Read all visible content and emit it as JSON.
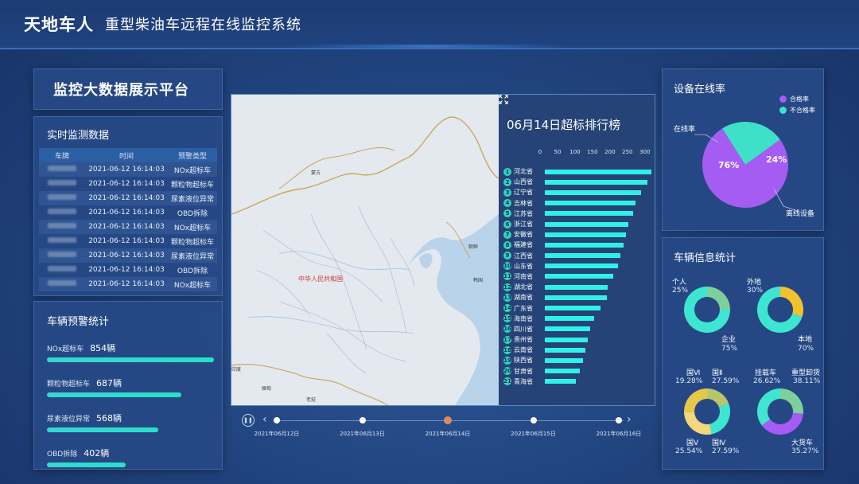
{
  "header": {
    "brand": "天地车人",
    "subtitle": "重型柴油车远程在线监控系统"
  },
  "platform": {
    "title": "监控大数据展示平台"
  },
  "realtime": {
    "title": "实时监测数据",
    "columns": [
      "车牌",
      "时间",
      "预警类型"
    ],
    "rows": [
      {
        "time": "2021-06-12  16:14:03",
        "type": "NOx超标车"
      },
      {
        "time": "2021-06-12  16:14:03",
        "type": "颗粒物超标车"
      },
      {
        "time": "2021-06-12  16:14:03",
        "type": "尿素液位异常"
      },
      {
        "time": "2021-06-12  16:14:03",
        "type": "OBD拆除"
      },
      {
        "time": "2021-06-12  16:14:03",
        "type": "NOx超标车"
      },
      {
        "time": "2021-06-12  16:14:03",
        "type": "颗粒物超标车"
      },
      {
        "time": "2021-06-12  16:14:03",
        "type": "尿素液位异常"
      },
      {
        "time": "2021-06-12  16:14:03",
        "type": "OBD拆除"
      },
      {
        "time": "2021-06-12  16:14:03",
        "type": "NOx超标车"
      }
    ]
  },
  "warning": {
    "title": "车辆预警统计",
    "items": [
      {
        "label": "NOx超标车",
        "count": "854辆",
        "value": 854
      },
      {
        "label": "颗粒物超标车",
        "count": "687辆",
        "value": 687
      },
      {
        "label": "尿素液位异常",
        "count": "568辆",
        "value": 568
      },
      {
        "label": "OBD拆除",
        "count": "402辆",
        "value": 402
      }
    ],
    "max": 854
  },
  "map": {
    "labels": [
      {
        "text": "中华人民共和国",
        "red": true
      },
      {
        "text": "蒙古",
        "red": false
      },
      {
        "text": "朝鲜",
        "red": false
      },
      {
        "text": "韩国",
        "red": false
      },
      {
        "text": "缅甸",
        "red": false
      },
      {
        "text": "老挝",
        "red": false
      },
      {
        "text": "印度",
        "red": false
      }
    ]
  },
  "ranking": {
    "title": "06月14日超标排行榜",
    "axis_ticks": [
      0,
      50,
      100,
      150,
      200,
      250,
      300
    ],
    "axis_max": 305,
    "items": [
      {
        "rank": 1,
        "name": "河北省",
        "value": 305
      },
      {
        "rank": 2,
        "name": "山西省",
        "value": 293
      },
      {
        "rank": 3,
        "name": "辽宁省",
        "value": 275
      },
      {
        "rank": 4,
        "name": "吉林省",
        "value": 260
      },
      {
        "rank": 5,
        "name": "江苏省",
        "value": 253
      },
      {
        "rank": 6,
        "name": "浙江省",
        "value": 240
      },
      {
        "rank": 7,
        "name": "安徽省",
        "value": 233
      },
      {
        "rank": 8,
        "name": "福建省",
        "value": 225
      },
      {
        "rank": 9,
        "name": "江西省",
        "value": 217
      },
      {
        "rank": 10,
        "name": "山东省",
        "value": 210
      },
      {
        "rank": 11,
        "name": "河南省",
        "value": 195
      },
      {
        "rank": 12,
        "name": "湖北省",
        "value": 180
      },
      {
        "rank": 13,
        "name": "湖南省",
        "value": 177
      },
      {
        "rank": 14,
        "name": "广东省",
        "value": 160
      },
      {
        "rank": 15,
        "name": "海南省",
        "value": 140
      },
      {
        "rank": 16,
        "name": "四川省",
        "value": 130
      },
      {
        "rank": 17,
        "name": "贵州省",
        "value": 122
      },
      {
        "rank": 18,
        "name": "云南省",
        "value": 115
      },
      {
        "rank": 19,
        "name": "陕西省",
        "value": 110
      },
      {
        "rank": 20,
        "name": "甘肃省",
        "value": 100
      },
      {
        "rank": 21,
        "name": "青海省",
        "value": 88
      }
    ]
  },
  "timeline": {
    "dates": [
      "2021年06月12日",
      "2021年06月13日",
      "2021年06月14日",
      "2021年06月15日",
      "2021年06月16日"
    ],
    "active_index": 2,
    "play_icon": "pause-icon"
  },
  "online": {
    "title": "设备在线率",
    "legend": [
      {
        "label": "合格率",
        "color": "#a45cf2"
      },
      {
        "label": "不合格率",
        "color": "#3fe0c8"
      }
    ],
    "slices": [
      {
        "label": "在线率",
        "value": 76,
        "pct": "76%",
        "color": "#a45cf2"
      },
      {
        "label": "离线设备",
        "value": 24,
        "pct": "24%",
        "color": "#3fe0c8"
      }
    ]
  },
  "vehinfo": {
    "title": "车辆信息统计",
    "donuts": [
      {
        "segments": [
          {
            "label": "个人",
            "pct": "25%",
            "value": 25,
            "color": "#7ed09a"
          },
          {
            "label": "企业",
            "pct": "75%",
            "value": 75,
            "color": "#3ee6d2"
          }
        ]
      },
      {
        "segments": [
          {
            "label": "外地",
            "pct": "30%",
            "value": 30,
            "color": "#f2c12e"
          },
          {
            "label": "本地",
            "pct": "70%",
            "value": 70,
            "color": "#3ee6d2"
          }
        ]
      },
      {
        "segments": [
          {
            "label": "国Ⅵ",
            "pct": "19.28%",
            "value": 19.28,
            "color": "#b9c56a"
          },
          {
            "label": "国Ⅱ",
            "pct": "27.59%",
            "value": 27.59,
            "color": "#3ee6d2"
          },
          {
            "label": "国Ⅳ",
            "pct": "27.59%",
            "value": 27.59,
            "color": "#f4d77a"
          },
          {
            "label": "国Ⅴ",
            "pct": "25.54%",
            "value": 25.54,
            "color": "#e5c84a"
          }
        ]
      },
      {
        "segments": [
          {
            "label": "挂载车",
            "pct": "26.62%",
            "value": 26.62,
            "color": "#7ed09a"
          },
          {
            "label": "重型卸货",
            "pct": "38.11%",
            "value": 38.11,
            "color": "#a45cf2"
          },
          {
            "label": "大货车",
            "pct": "35.27%",
            "value": 35.27,
            "color": "#3ee6d2"
          }
        ]
      }
    ]
  }
}
